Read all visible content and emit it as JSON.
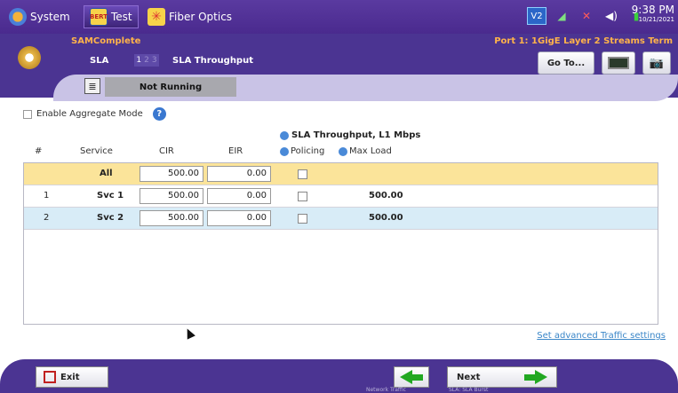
{
  "top_tabs": [
    {
      "label": "System",
      "icon": "system-icon"
    },
    {
      "label": "Test",
      "icon": "bert-test-icon",
      "icon_text": "BERT"
    },
    {
      "label": "Fiber Optics",
      "icon": "fiber-optics-icon"
    }
  ],
  "status": {
    "v2_label": "V2",
    "time": "9:38 PM",
    "date": "10/21/2021"
  },
  "header": {
    "app_name": "SAMComplete",
    "port_info": "Port 1: 1GigE Layer 2 Streams Term",
    "section": "SLA",
    "steps": [
      "1",
      "2",
      "3"
    ],
    "page_title": "SLA Throughput",
    "goto_label": "Go To..."
  },
  "run_status": "Not Running",
  "aggregate_mode_label": "Enable Aggregate Mode",
  "group_header": "SLA Throughput, L1 Mbps",
  "columns": {
    "num": "#",
    "service": "Service",
    "cir": "CIR",
    "eir": "EIR",
    "policing": "Policing",
    "max_load": "Max Load"
  },
  "rows": [
    {
      "num": "",
      "service": "All",
      "cir": "500.00",
      "eir": "0.00",
      "max_load": ""
    },
    {
      "num": "1",
      "service": "Svc 1",
      "cir": "500.00",
      "eir": "0.00",
      "max_load": "500.00"
    },
    {
      "num": "2",
      "service": "Svc 2",
      "cir": "500.00",
      "eir": "0.00",
      "max_load": "500.00"
    }
  ],
  "advanced_link": "Set advanced Traffic settings",
  "footer": {
    "exit_label": "Exit",
    "next_label": "Next",
    "back_caption": "Network Traffic",
    "next_caption": "SLA: SLA Burst"
  },
  "colors": {
    "header_purple": "#4b3492",
    "accent_orange": "#ffb34a",
    "all_row": "#fbe49a",
    "alt_row": "#d8ecf7",
    "link": "#3a86c8"
  }
}
